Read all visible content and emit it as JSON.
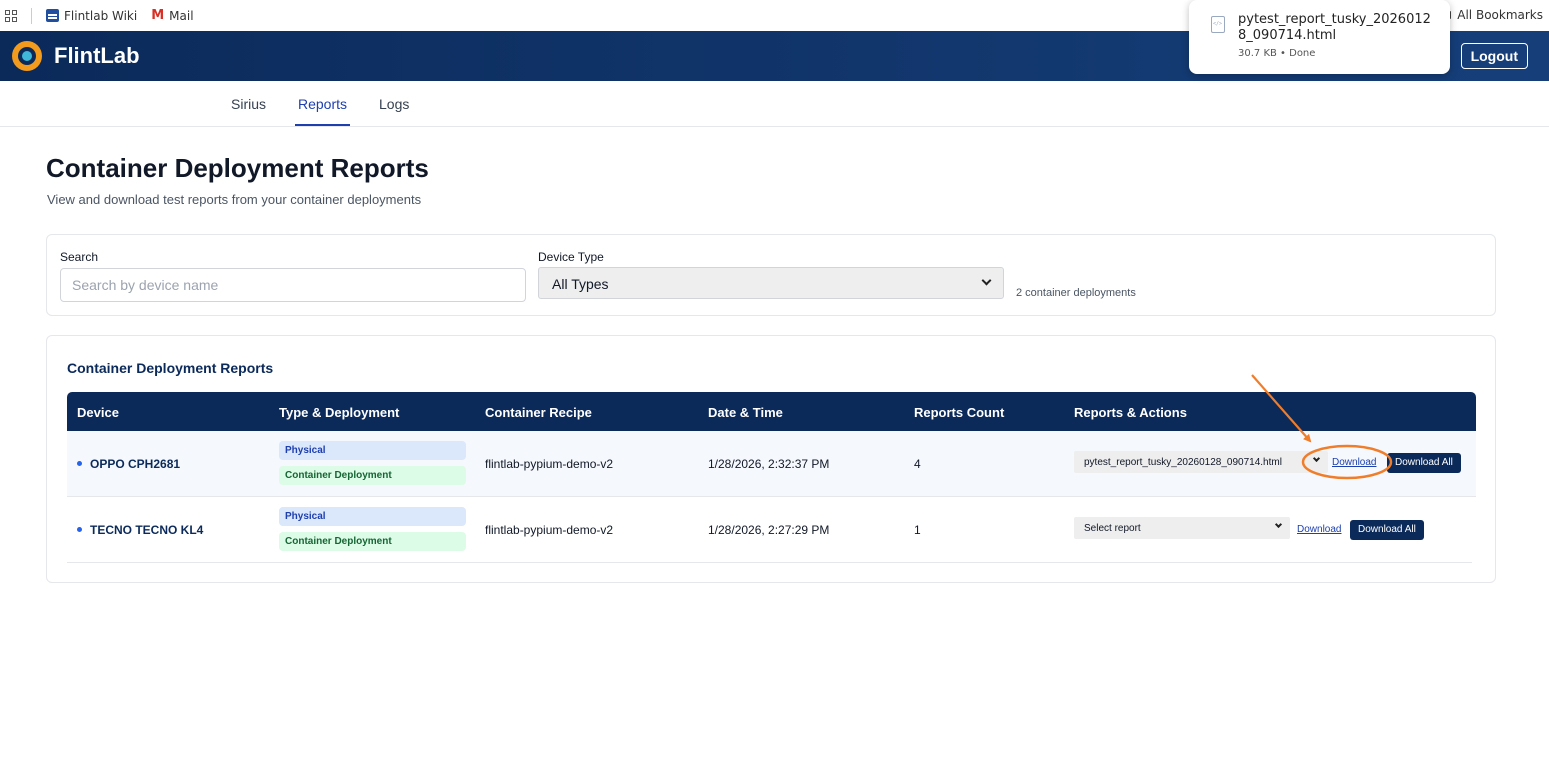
{
  "bookmarks": {
    "items": [
      "Flintlab Wiki",
      "Mail"
    ],
    "all_bookmarks": "All Bookmarks"
  },
  "header": {
    "app_title": "FlintLab",
    "logout_label": "Logout",
    "accent_color": "#0b2a5a"
  },
  "download_popup": {
    "filename": "pytest_report_tusky_20260128_090714.html",
    "meta": "30.7 KB • Done"
  },
  "nav": {
    "tabs": [
      {
        "label": "Sirius",
        "active": false
      },
      {
        "label": "Reports",
        "active": true
      },
      {
        "label": "Logs",
        "active": false
      }
    ]
  },
  "page": {
    "title": "Container Deployment Reports",
    "subtitle": "View and download test reports from your container deployments"
  },
  "filters": {
    "search_label": "Search",
    "search_placeholder": "Search by device name",
    "search_value": "",
    "device_type_label": "Device Type",
    "device_type_value": "All Types",
    "deployment_count": "2 container deployments"
  },
  "table": {
    "title": "Container Deployment Reports",
    "columns": [
      "Device",
      "Type & Deployment",
      "Container Recipe",
      "Date & Time",
      "Reports Count",
      "Reports & Actions"
    ],
    "rows": [
      {
        "device": "OPPO CPH2681",
        "type": "Physical",
        "deployment": "Container Deployment",
        "recipe": "flintlab-pypium-demo-v2",
        "datetime": "1/28/2026, 2:32:37 PM",
        "reports_count": "4",
        "selected_report": "pytest_report_tusky_20260128_090714.html",
        "download_label": "Download",
        "download_all_label": "Download All"
      },
      {
        "device": "TECNO TECNO KL4",
        "type": "Physical",
        "deployment": "Container Deployment",
        "recipe": "flintlab-pypium-demo-v2",
        "datetime": "1/28/2026, 2:27:29 PM",
        "reports_count": "1",
        "selected_report": "Select report",
        "download_label": "Download",
        "download_all_label": "Download All"
      }
    ]
  },
  "annotation": {
    "color": "#f07d2a"
  }
}
